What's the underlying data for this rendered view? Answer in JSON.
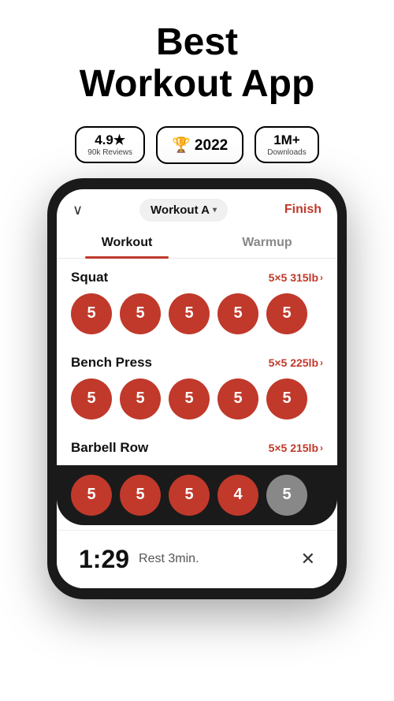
{
  "header": {
    "title_line1": "Best",
    "title_line2": "Workout App"
  },
  "badges": [
    {
      "id": "rating",
      "main": "4.9★",
      "sub": "90k Reviews"
    },
    {
      "id": "award",
      "main": "🏆 2022",
      "sub": null
    },
    {
      "id": "downloads",
      "main": "1M+",
      "sub": "Downloads"
    }
  ],
  "phone": {
    "workout_selector": "Workout A",
    "finish_label": "Finish",
    "tabs": [
      {
        "label": "Workout",
        "active": true
      },
      {
        "label": "Warmup",
        "active": false
      }
    ],
    "exercises": [
      {
        "name": "Squat",
        "sets_info": "5×5 315lb",
        "reps": [
          5,
          5,
          5,
          5,
          5
        ]
      },
      {
        "name": "Bench Press",
        "sets_info": "5×5 225lb",
        "reps": [
          5,
          5,
          5,
          5,
          5
        ]
      },
      {
        "name": "Barbell Row",
        "sets_info": "5×5 215lb",
        "reps": [
          5,
          5,
          5,
          4,
          5
        ]
      }
    ],
    "black_bar_reps": [
      5,
      5,
      5,
      4
    ],
    "black_bar_grey": 5,
    "rest_timer": {
      "time": "1:29",
      "label": "Rest 3min."
    }
  },
  "icons": {
    "chevron_down": "∨",
    "chevron_right": "›",
    "close": "✕",
    "trophy": "🏆",
    "star": "★",
    "selector_arrow": "▾"
  }
}
